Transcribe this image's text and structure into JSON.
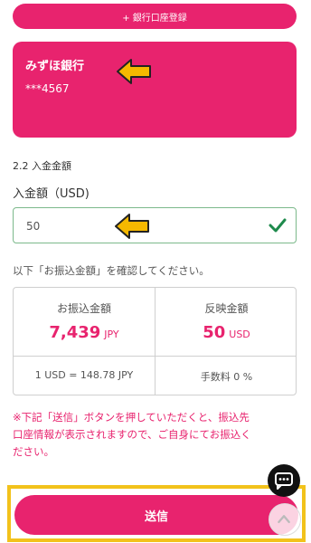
{
  "header": {
    "add_bank_label": "+ 銀行口座登録"
  },
  "bank_card": {
    "bank_name": "みずほ銀行",
    "account": "***4567"
  },
  "form": {
    "section_title": "2.2 入金金額",
    "amount_label": "入金額（USD)",
    "amount_value": "50"
  },
  "confirm": {
    "instruction": "以下「お振込金額」を確認してください。"
  },
  "summary": {
    "transfer_label": "お振込金額",
    "transfer_amount": "7,439",
    "transfer_currency": "JPY",
    "reflected_label": "反映金額",
    "reflected_amount": "50",
    "reflected_currency": "USD",
    "rate": "1 USD = 148.78 JPY",
    "fee": "手数料 0 %"
  },
  "notice": {
    "line1": "※下記「送信」ボタンを押していただくと、振込先",
    "line2": "口座情報が表示されますので、ご自身にてお振込く",
    "line3": "ださい。"
  },
  "footer": {
    "submit_label": "送信"
  },
  "colors": {
    "brand": "#e8236e",
    "arrow": "#f5b800",
    "highlight": "#f2c21b",
    "valid": "#1e8a4c"
  },
  "icons": [
    "arrow-pointer-icon",
    "checkmark-icon",
    "chat-icon",
    "chevron-up-icon"
  ]
}
